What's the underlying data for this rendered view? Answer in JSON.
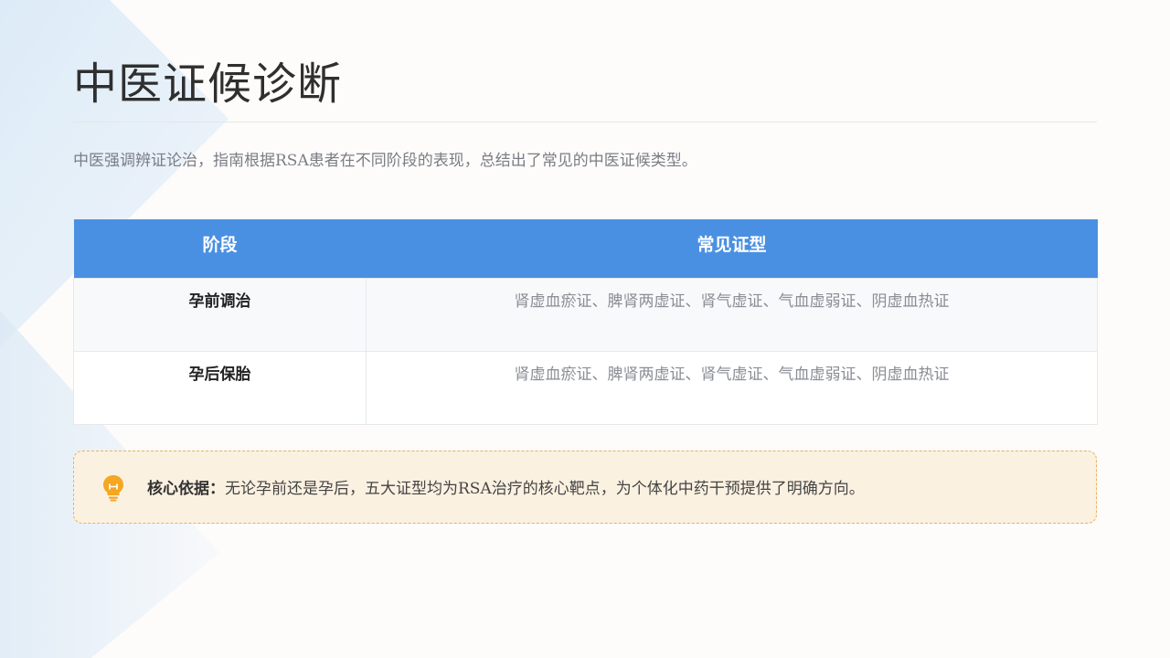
{
  "title": "中医证候诊断",
  "intro": "中医强调辨证论治，指南根据RSA患者在不同阶段的表现，总结出了常见的中医证候类型。",
  "table": {
    "headers": [
      "阶段",
      "常见证型"
    ],
    "rows": [
      {
        "stage": "孕前调治",
        "types": "肾虚血瘀证、脾肾两虚证、肾气虚证、气血虚弱证、阴虚血热证"
      },
      {
        "stage": "孕后保胎",
        "types": "肾虚血瘀证、脾肾两虚证、肾气虚证、气血虚弱证、阴虚血热证"
      }
    ]
  },
  "callout": {
    "icon": "lightbulb-icon",
    "lead": "核心依据：",
    "text": "无论孕前还是孕后，五大证型均为RSA治疗的核心靶点，为个体化中药干预提供了明确方向。"
  },
  "colors": {
    "header_blue": "#4a90e2",
    "accent_orange": "#f5a623",
    "callout_bg": "#fbf1e1",
    "callout_border": "#e8b15a"
  }
}
